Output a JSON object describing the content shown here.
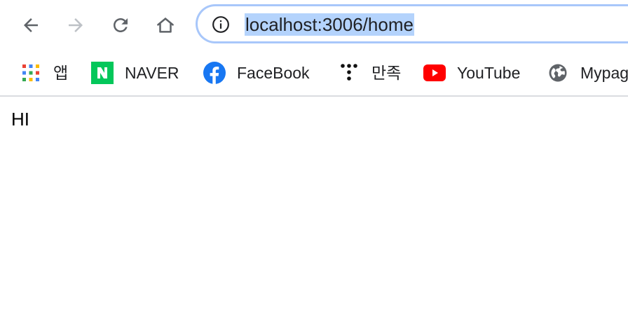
{
  "omnibox": {
    "url": "localhost:3006/home"
  },
  "bookmarks": {
    "items": [
      {
        "label": "앱",
        "icon": "apps-grid-icon"
      },
      {
        "label": "NAVER",
        "icon": "naver-icon"
      },
      {
        "label": "FaceBook",
        "icon": "facebook-icon"
      },
      {
        "label": "만족",
        "icon": "dots-icon"
      },
      {
        "label": "YouTube",
        "icon": "youtube-icon"
      },
      {
        "label": "Mypage",
        "icon": "globe-icon"
      }
    ]
  },
  "page": {
    "text": "HI"
  },
  "colors": {
    "omnibox_border": "#a8c7fa",
    "url_selection": "#b4d3fc",
    "naver_green": "#03c75a",
    "facebook_blue": "#1877f2",
    "youtube_red": "#ff0000"
  }
}
